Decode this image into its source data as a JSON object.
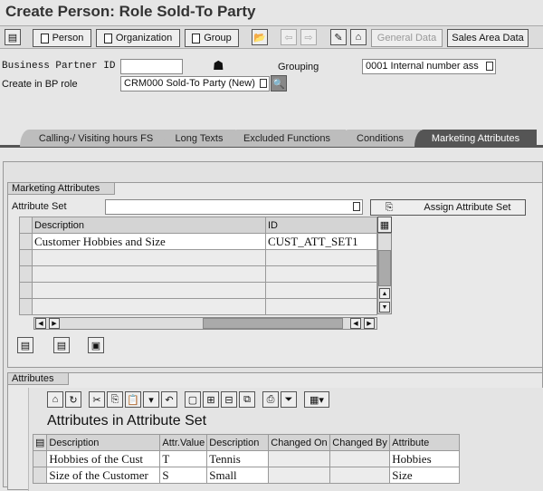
{
  "title": "Create Person: Role Sold-To Party",
  "toolbar": {
    "person": "Person",
    "organization": "Organization",
    "group": "Group",
    "general_data": "General Data",
    "sales_area_data": "Sales Area Data"
  },
  "header": {
    "bp_id_label": "Business Partner ID",
    "bp_id_value": "",
    "grouping_label": "Grouping",
    "grouping_value": "0001 Internal number ass",
    "role_label": "Create in BP role",
    "role_value": "CRM000 Sold-To Party (New)"
  },
  "tabs": [
    {
      "label": "Calling-/ Visiting hours FS"
    },
    {
      "label": "Long Texts"
    },
    {
      "label": "Excluded Functions"
    },
    {
      "label": "Conditions"
    },
    {
      "label": "Marketing Attributes",
      "active": true
    }
  ],
  "marketing": {
    "group_label": "Marketing Attributes",
    "attr_set_label": "Attribute Set",
    "attr_set_value": "",
    "assign_button": "Assign Attribute Set",
    "columns": [
      "Description",
      "ID"
    ],
    "rows": [
      [
        "Customer Hobbies and Size",
        "CUST_ATT_SET1"
      ]
    ]
  },
  "attributes": {
    "group_label": "Attributes",
    "title": "Attributes in Attribute Set",
    "columns": [
      "Description",
      "Attr.Value",
      "Description",
      "Changed On",
      "Changed By",
      "Attribute"
    ],
    "rows": [
      [
        "Hobbies of the Cust",
        "T",
        "Tennis",
        "",
        "",
        "Hobbies"
      ],
      [
        "Size of the Customer",
        "S",
        "Small",
        "",
        "",
        "Size"
      ]
    ]
  }
}
